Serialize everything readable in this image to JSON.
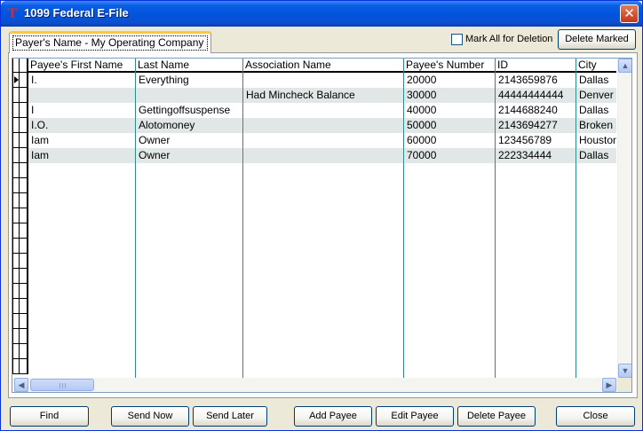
{
  "window": {
    "title": "1099 Federal E-File",
    "close_glyph": "✕"
  },
  "tab": {
    "label": "Payer's Name - My Operating Company"
  },
  "mark_all": {
    "label": "Mark All for Deletion",
    "checked": false
  },
  "toolbar": {
    "delete_marked": "Delete Marked"
  },
  "grid": {
    "columns": [
      "Payee's First Name",
      "Last Name",
      "Association Name",
      "Payee's Number",
      "ID",
      "City"
    ],
    "rows": [
      [
        "I.",
        "Everything",
        "",
        "20000",
        "2143659876",
        "Dallas"
      ],
      [
        "",
        "",
        "Had Mincheck Balance",
        "30000",
        "44444444444",
        "Denver"
      ],
      [
        "I",
        "Gettingoffsuspense",
        "",
        "40000",
        "2144688240",
        "Dallas"
      ],
      [
        "I.O.",
        "Alotomoney",
        "",
        "50000",
        "2143694277",
        "Broken"
      ],
      [
        "Iam",
        "Owner",
        "",
        "60000",
        "123456789",
        "Houston"
      ],
      [
        "Iam",
        "Owner",
        "",
        "70000",
        "222334444",
        "Dallas"
      ]
    ],
    "current_row": 0,
    "alt_row_color": "#e1e6e6",
    "grid_line_color": "#2e8b8b"
  },
  "buttons": {
    "find": "Find",
    "send_now": "Send Now",
    "send_later": "Send Later",
    "add_payee": "Add Payee",
    "edit_payee": "Edit Payee",
    "delete_payee": "Delete Payee",
    "close": "Close"
  },
  "icons": {
    "app": "red-t-logo-icon",
    "scroll_up": "▲",
    "scroll_down": "▼",
    "scroll_left": "◀",
    "scroll_right": "▶"
  },
  "colors": {
    "title_bar": "#0254de",
    "window_bg": "#ece9d8",
    "tab_highlight": "#ffc83c"
  }
}
